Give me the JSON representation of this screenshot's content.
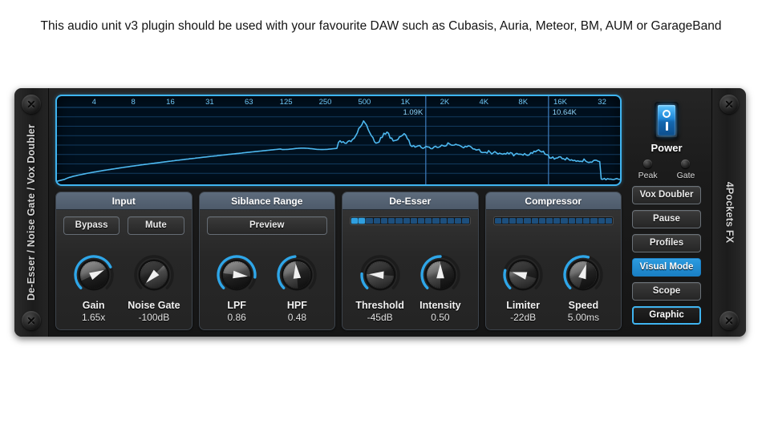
{
  "caption": "This audio unit v3 plugin should be used with your favourite DAW such as Cubasis, Auria, Meteor, BM, AUM or GarageBand",
  "rack": {
    "left_label": "De-Esser / Noise Gate / Vox Doubler",
    "right_label": "4Pockets FX"
  },
  "spectrum": {
    "freq_labels": [
      "4",
      "8",
      "16",
      "31",
      "63",
      "125",
      "250",
      "500",
      "1K",
      "2K",
      "4K",
      "8K",
      "16K",
      "32"
    ],
    "markers": [
      {
        "label": "1.09K",
        "align": "right"
      },
      {
        "label": "10.64K",
        "align": "left"
      }
    ],
    "trace_color": "#4db8ef",
    "grid_color": "#123a5e",
    "background": "#00101e"
  },
  "panels": [
    {
      "title": "Input",
      "buttons": [
        "Bypass",
        "Mute"
      ],
      "knobs": [
        {
          "name": "Gain",
          "value": "1.65x",
          "arc": 0.74,
          "pointer": 0.74
        },
        {
          "name": "Noise Gate",
          "value": "-100dB",
          "arc": 0.0,
          "pointer": 0.0
        }
      ]
    },
    {
      "title": "Siblance Range",
      "buttons": [
        "Preview"
      ],
      "knobs": [
        {
          "name": "LPF",
          "value": "0.86",
          "arc": 0.86,
          "pointer": 0.86
        },
        {
          "name": "HPF",
          "value": "0.48",
          "arc": 0.48,
          "pointer": 0.48
        }
      ]
    },
    {
      "title": "De-Esser",
      "meter": {
        "segments": 16,
        "lit": 2
      },
      "knobs": [
        {
          "name": "Threshold",
          "value": "-45dB",
          "arc": 0.18,
          "pointer": 0.18
        },
        {
          "name": "Intensity",
          "value": "0.50",
          "arc": 0.5,
          "pointer": 0.5
        }
      ]
    },
    {
      "title": "Compressor",
      "meter": {
        "segments": 16,
        "lit": 0
      },
      "knobs": [
        {
          "name": "Limiter",
          "value": "-22dB",
          "arc": 0.22,
          "pointer": 0.22
        },
        {
          "name": "Speed",
          "value": "5.00ms",
          "arc": 0.56,
          "pointer": 0.56
        }
      ]
    }
  ],
  "side_panel": {
    "power_label": "Power",
    "power_icon_on": "power-circle-glyph",
    "power_icon_off": "power-bar-glyph",
    "leds": [
      {
        "label": "Peak",
        "lit": false
      },
      {
        "label": "Gate",
        "lit": false
      }
    ],
    "buttons": [
      {
        "label": "Vox Doubler",
        "state": "normal"
      },
      {
        "label": "Pause",
        "state": "normal"
      },
      {
        "label": "Profiles",
        "state": "normal"
      },
      {
        "label": "Visual Mode",
        "state": "active"
      },
      {
        "label": "Scope",
        "state": "normal"
      },
      {
        "label": "Graphic",
        "state": "outlined"
      }
    ]
  },
  "colors": {
    "accent_blue": "#3fb4f0",
    "active_blue": "#2b9be0",
    "panel_header": "#5d6b7c",
    "rack_dark": "#1b1b1b"
  }
}
